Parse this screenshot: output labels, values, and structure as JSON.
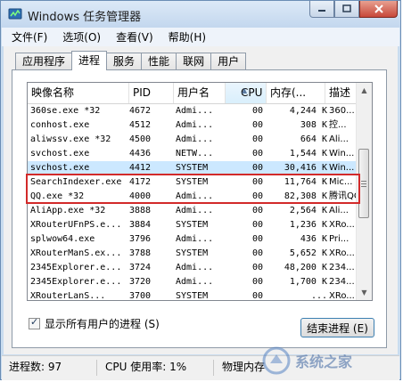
{
  "window": {
    "title": "Windows 任务管理器"
  },
  "menubar": {
    "items": [
      "文件(F)",
      "选项(O)",
      "查看(V)",
      "帮助(H)"
    ]
  },
  "tabs": [
    "应用程序",
    "进程",
    "服务",
    "性能",
    "联网",
    "用户"
  ],
  "active_tab": "进程",
  "columns": {
    "image": "映像名称",
    "pid": "PID",
    "user": "用户名",
    "cpu": "CPU",
    "mem": "内存(...",
    "desc": "描述"
  },
  "rows": [
    {
      "image": "360se.exe *32",
      "pid": "4672",
      "user": "Admi...",
      "cpu": "00",
      "mem": "4,244 K",
      "desc": "360..."
    },
    {
      "image": "conhost.exe",
      "pid": "4512",
      "user": "Admi...",
      "cpu": "00",
      "mem": "308 K",
      "desc": "控..."
    },
    {
      "image": "aliwssv.exe *32",
      "pid": "4500",
      "user": "Admi...",
      "cpu": "00",
      "mem": "664 K",
      "desc": "Ali..."
    },
    {
      "image": "svchost.exe",
      "pid": "4436",
      "user": "NETW...",
      "cpu": "00",
      "mem": "1,544 K",
      "desc": "Win..."
    },
    {
      "image": "svchost.exe",
      "pid": "4412",
      "user": "SYSTEM",
      "cpu": "00",
      "mem": "30,416 K",
      "desc": "Win..."
    },
    {
      "image": "SearchIndexer.exe",
      "pid": "4172",
      "user": "SYSTEM",
      "cpu": "00",
      "mem": "11,764 K",
      "desc": "Mic..."
    },
    {
      "image": "QQ.exe *32",
      "pid": "4000",
      "user": "Admi...",
      "cpu": "00",
      "mem": "82,308 K",
      "desc": "腾讯QQ"
    },
    {
      "image": "AliApp.exe *32",
      "pid": "3888",
      "user": "Admi...",
      "cpu": "00",
      "mem": "2,564 K",
      "desc": "Ali..."
    },
    {
      "image": "XRouterUFnPS.e...",
      "pid": "3884",
      "user": "SYSTEM",
      "cpu": "00",
      "mem": "1,236 K",
      "desc": "XRo..."
    },
    {
      "image": "splwow64.exe",
      "pid": "3796",
      "user": "Admi...",
      "cpu": "00",
      "mem": "436 K",
      "desc": "Pri..."
    },
    {
      "image": "XRouterManS.ex...",
      "pid": "3788",
      "user": "SYSTEM",
      "cpu": "00",
      "mem": "5,652 K",
      "desc": "XRo..."
    },
    {
      "image": "2345Explorer.e...",
      "pid": "3724",
      "user": "Admi...",
      "cpu": "00",
      "mem": "48,200 K",
      "desc": "234..."
    },
    {
      "image": "2345Explorer.e...",
      "pid": "3720",
      "user": "Admi...",
      "cpu": "00",
      "mem": "1,700 K",
      "desc": "234..."
    },
    {
      "image": "XRouterLanS...",
      "pid": "3700",
      "user": "SYSTEM",
      "cpu": "00",
      "mem": "...",
      "desc": "XRo..."
    }
  ],
  "show_all_label": "显示所有用户的进程 (S)",
  "end_process_label": "结束进程 (E)",
  "status": {
    "processes": "进程数: 97",
    "cpu": "CPU 使用率: 1%",
    "memory": "物理内存"
  },
  "watermark": "系统之家"
}
